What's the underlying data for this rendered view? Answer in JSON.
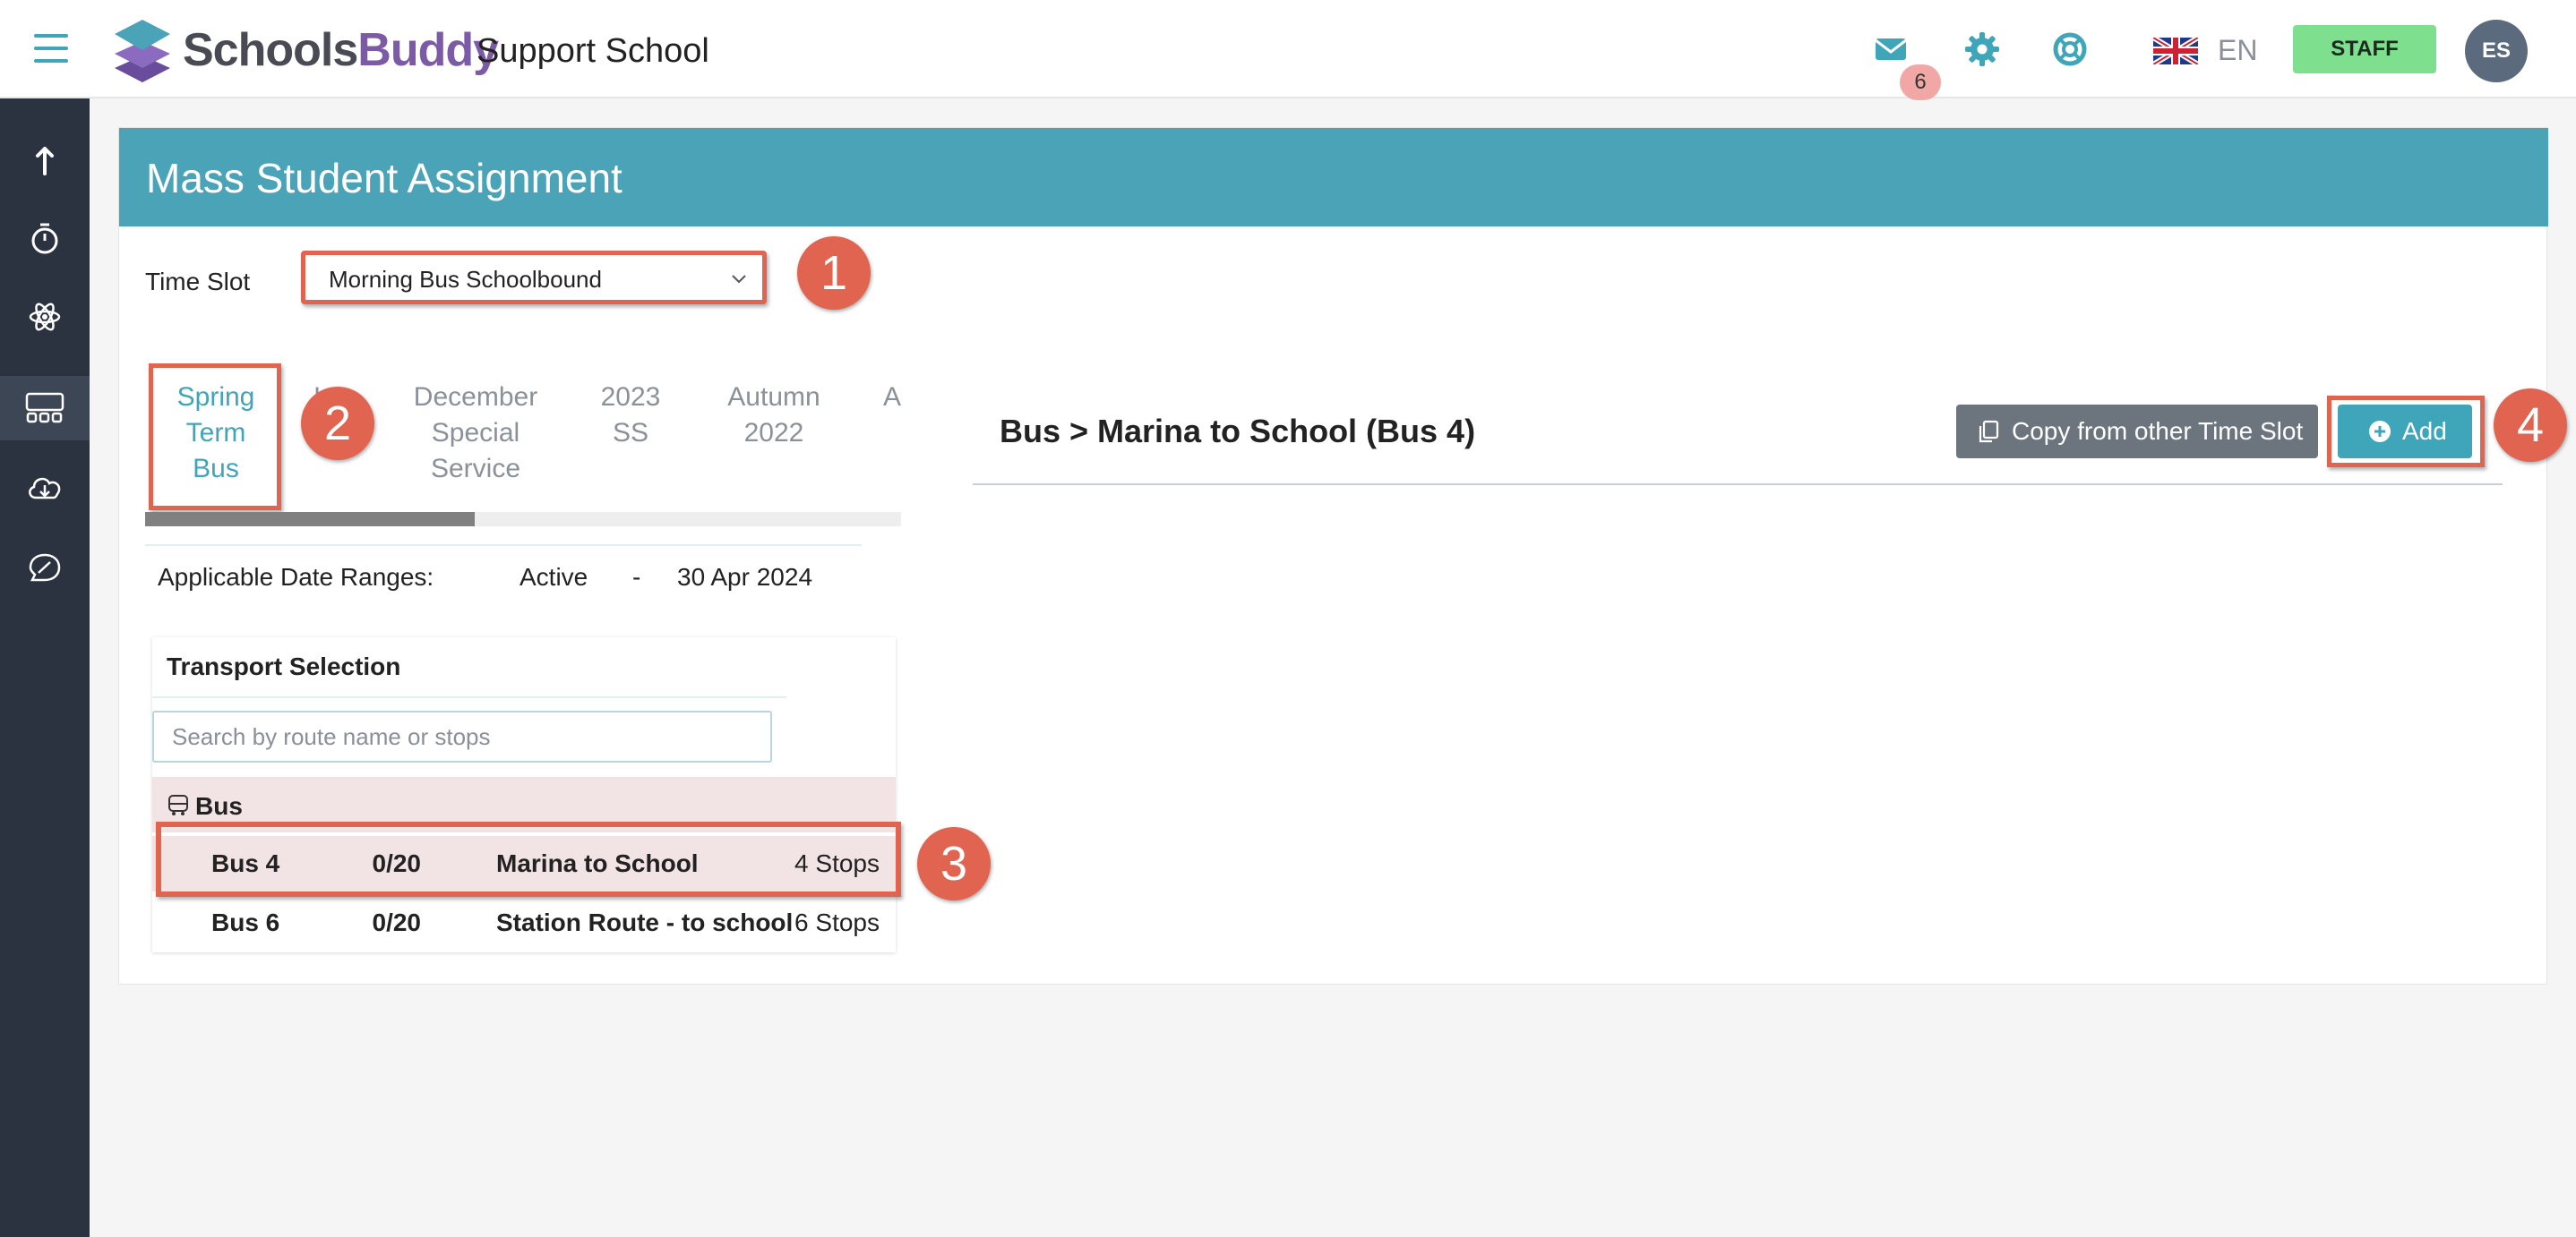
{
  "header": {
    "logo_part1": "Schools",
    "logo_part2": "Buddy",
    "school_name": "Support School",
    "messages_count": "6",
    "language": "EN",
    "staff_label": "STAFF",
    "avatar_initials": "ES"
  },
  "page": {
    "title": "Mass Student Assignment",
    "time_slot_label": "Time Slot",
    "time_slot_value": "Morning Bus Schoolbound"
  },
  "tabs": [
    {
      "l1": "Spring",
      "l2": "Term",
      "l3": "Bus"
    },
    {
      "l1": "I"
    },
    {
      "l1": "December",
      "l2": "Special",
      "l3": "Service"
    },
    {
      "l1": "2023",
      "l2": "SS"
    },
    {
      "l1": "Autumn",
      "l2": "2022"
    },
    {
      "l1": "A"
    }
  ],
  "date_range": {
    "label": "Applicable Date Ranges:",
    "status": "Active",
    "separator": "-",
    "end": "30 Apr 2024"
  },
  "transport": {
    "title": "Transport Selection",
    "search_placeholder": "Search by route name or stops",
    "group_label": "Bus",
    "rows": [
      {
        "name": "Bus 4",
        "capacity": "0/20",
        "route": "Marina to School",
        "stops": "4 Stops"
      },
      {
        "name": "Bus 6",
        "capacity": "0/20",
        "route": "Station Route - to school",
        "stops": "6 Stops"
      }
    ]
  },
  "detail": {
    "title": "Bus > Marina to School (Bus 4)",
    "copy_label": "Copy from other Time Slot",
    "add_label": "Add"
  },
  "callouts": [
    "1",
    "2",
    "3",
    "4"
  ],
  "colors": {
    "accent": "#4aa3b6",
    "highlight": "#e06450",
    "sidebar": "#2b3340",
    "staff": "#7ee08e"
  }
}
